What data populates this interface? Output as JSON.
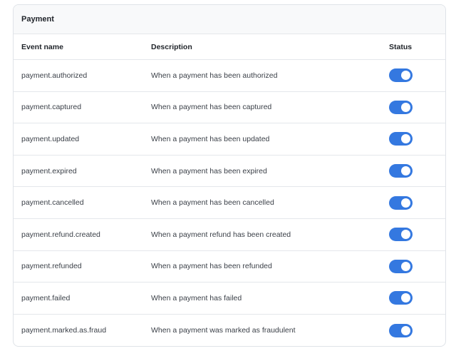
{
  "section": {
    "title": "Payment"
  },
  "table": {
    "headers": {
      "event": "Event name",
      "description": "Description",
      "status": "Status"
    },
    "rows": [
      {
        "event": "payment.authorized",
        "description": "When a payment has been authorized",
        "enabled": true
      },
      {
        "event": "payment.captured",
        "description": "When a payment has been captured",
        "enabled": true
      },
      {
        "event": "payment.updated",
        "description": "When a payment has been updated",
        "enabled": true
      },
      {
        "event": "payment.expired",
        "description": "When a payment has been expired",
        "enabled": true
      },
      {
        "event": "payment.cancelled",
        "description": "When a payment has been cancelled",
        "enabled": true
      },
      {
        "event": "payment.refund.created",
        "description": "When a payment refund has been created",
        "enabled": true
      },
      {
        "event": "payment.refunded",
        "description": "When a payment has been refunded",
        "enabled": true
      },
      {
        "event": "payment.failed",
        "description": "When a payment has failed",
        "enabled": true
      },
      {
        "event": "payment.marked.as.fraud",
        "description": "When a payment was marked as fraudulent",
        "enabled": true
      }
    ]
  },
  "colors": {
    "toggle_on": "#3478e0",
    "toggle_off": "#c7ccd3"
  }
}
